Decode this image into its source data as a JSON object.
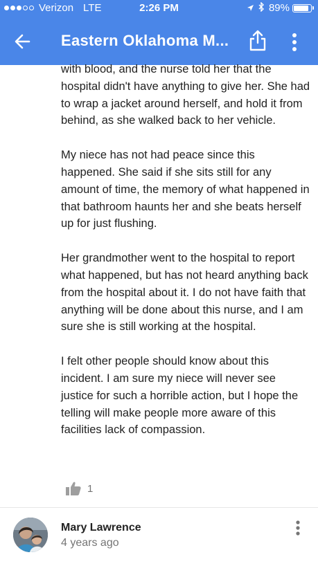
{
  "status_bar": {
    "carrier": "Verizon",
    "network": "LTE",
    "time": "2:26 PM",
    "battery": "89%",
    "battery_level": 0.89
  },
  "toolbar": {
    "title": "Eastern Oklahoma M...",
    "back_icon": "arrow-left-icon",
    "share_icon": "share-icon",
    "more_icon": "more-vertical-icon"
  },
  "review": {
    "paragraphs": [
      "with blood, and the nurse told her that the hospital didn't have anything to give her. She had to wrap a jacket around herself, and hold it from behind, as she walked back to her vehicle.",
      "My niece has not had peace since this happened.  She said if she sits still for any amount of time, the memory of what happened in that bathroom haunts her and she beats herself up for just flushing.",
      "Her grandmother went to the hospital to report what happened, but has not heard anything back from the hospital about it.  I do not have faith that anything will be done about this nurse, and I am sure she is still working at the hospital.",
      "I felt other people should know about this incident.  I am sure my niece will never see justice for such a horrible action, but I hope the telling will make people more aware of this facilities lack of compassion."
    ],
    "like_count": "1",
    "like_icon": "thumbs-up-icon"
  },
  "next_review": {
    "author": "Mary Lawrence",
    "time_ago": "4 years ago",
    "more_icon": "more-vertical-icon"
  },
  "colors": {
    "header_bg": "#4a86e8",
    "text_primary": "#222222",
    "text_secondary": "#757575"
  }
}
